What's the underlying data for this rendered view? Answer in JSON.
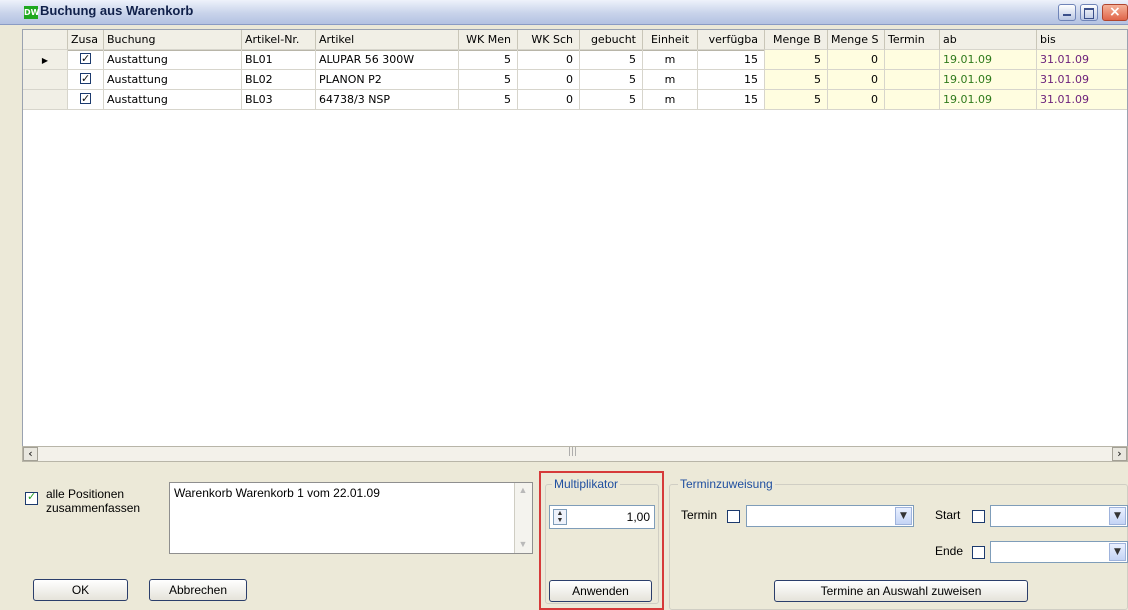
{
  "window": {
    "icon_text": "DW",
    "title": "Buchung aus Warenkorb"
  },
  "grid": {
    "columns": [
      "Zusa",
      "Buchung",
      "Artikel-Nr.",
      "Artikel",
      "WK Men",
      "WK Sch",
      "gebucht",
      "Einheit",
      "verfügba",
      "Menge B",
      "Menge S",
      "Termin",
      "ab",
      "bis"
    ],
    "rows": [
      {
        "zusa": true,
        "buchung": "Austattung",
        "artikel_nr": "BL01",
        "artikel": "ALUPAR 56 300W",
        "wk_men": "5",
        "wk_sch": "0",
        "gebucht": "5",
        "einheit": "m",
        "verfuegbar": "15",
        "menge_b": "5",
        "menge_s": "0",
        "termin": "",
        "ab": "19.01.09",
        "bis": "31.01.09"
      },
      {
        "zusa": true,
        "buchung": "Austattung",
        "artikel_nr": "BL02",
        "artikel": "PLANON P2",
        "wk_men": "5",
        "wk_sch": "0",
        "gebucht": "5",
        "einheit": "m",
        "verfuegbar": "15",
        "menge_b": "5",
        "menge_s": "0",
        "termin": "",
        "ab": "19.01.09",
        "bis": "31.01.09"
      },
      {
        "zusa": true,
        "buchung": "Austattung",
        "artikel_nr": "BL03",
        "artikel": "64738/3 NSP",
        "wk_men": "5",
        "wk_sch": "0",
        "gebucht": "5",
        "einheit": "m",
        "verfuegbar": "15",
        "menge_b": "5",
        "menge_s": "0",
        "termin": "",
        "ab": "19.01.09",
        "bis": "31.01.09"
      }
    ]
  },
  "bottom": {
    "merge_label_1": "alle Positionen",
    "merge_label_2": "zusammenfassen",
    "memo_text": "Warenkorb Warenkorb 1 vom 22.01.09",
    "ok_label": "OK",
    "cancel_label": "Abbrechen"
  },
  "multiplikator": {
    "legend": "Multiplikator",
    "value": "1,00",
    "apply_label": "Anwenden"
  },
  "terminzuweisung": {
    "legend": "Terminzuweisung",
    "termin_label": "Termin",
    "start_label": "Start",
    "ende_label": "Ende",
    "assign_label": "Termine an Auswahl zuweisen"
  },
  "colors": {
    "highlight_border": "#d63a3a",
    "date_ab": "#2f7a1b",
    "date_bis": "#6b1e7a",
    "editable_bg": "#fffde0"
  }
}
